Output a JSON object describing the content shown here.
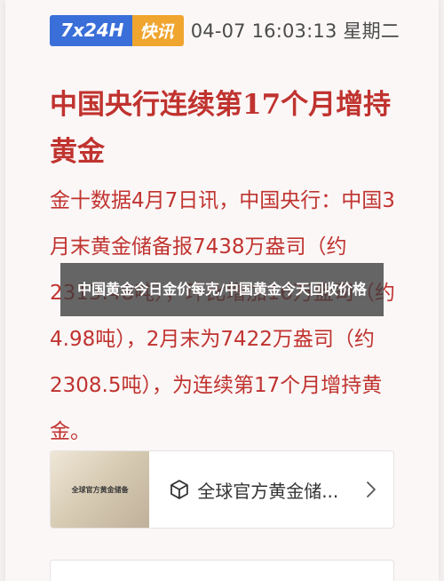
{
  "header": {
    "badge_left": "7x24H",
    "badge_right": "快讯",
    "datetime": "04-07 16:03:13 星期二"
  },
  "article": {
    "headline": "中国央行连续第17个月增持黄金",
    "body": "金十数据4月7日讯，中国央行：中国3月末黄金储备报7438万盎司（约2313.48吨），环比增加16万盎司（约4.98吨），2月末为7422万盎司（约2308.5吨），为连续第17个月增持黄金。"
  },
  "overlay": {
    "text": "中国黄金今日金价每克/中国黄金今天回收价格"
  },
  "related": {
    "thumb_caption": "全球官方黄金储备",
    "title": "全球官方黄金储..."
  },
  "icons": {
    "cube": "cube-icon",
    "chevron": "chevron-right-icon"
  },
  "colors": {
    "accent_red": "#c0332f",
    "badge_blue": "#3a6fd9",
    "badge_orange": "#f0a52f"
  }
}
